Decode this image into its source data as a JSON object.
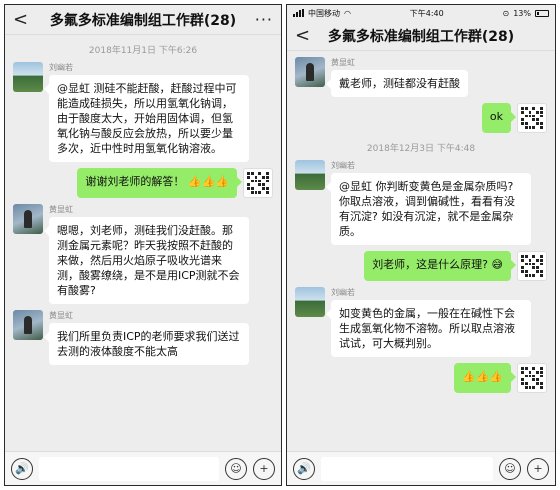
{
  "left": {
    "nav": {
      "back": "<",
      "title": "多氟多标准编制组工作群(28)",
      "more": "···"
    },
    "timestamp": "2018年11月1日 下午6:26",
    "messages": [
      {
        "dir": "in",
        "sender": "刘幽若",
        "text": "@显虹 测硅不能赶酸，赶酸过程中可能造成硅损失，所以用氢氧化钠调，由于酸度太大，开始用固体调，但氢氧化钠与酸反应会放热，所以要少量多次，近中性时用氢氧化钠溶液。"
      },
      {
        "dir": "out",
        "text": "谢谢刘老师的解答！",
        "emoji": "👍👍👍"
      },
      {
        "dir": "in",
        "sender": "黄显虹",
        "text": "嗯嗯，刘老师，测硅我们没赶酸。那测金属元素呢？昨天我按照不赶酸的来做，然后用火焰原子吸收光谱来测，酸雾缭绕，是不是用ICP测就不会有酸雾?"
      },
      {
        "dir": "in",
        "sender": "黄显虹",
        "text": "我们所里负责ICP的老师要求我们送过去测的液体酸度不能太高"
      }
    ]
  },
  "right": {
    "status": {
      "carrier": "中国移动",
      "time": "下午4:40",
      "battery": "13%"
    },
    "nav": {
      "back": "<",
      "title": "多氟多标准编制组工作群(28)"
    },
    "messages_top": [
      {
        "dir": "in",
        "sender": "黄显虹",
        "text": "戴老师，测硅都没有赶酸"
      },
      {
        "dir": "out",
        "text": "ok"
      }
    ],
    "timestamp": "2018年12月3日 下午4:48",
    "messages_bottom": [
      {
        "dir": "in",
        "sender": "刘幽若",
        "text": "@显虹 你判断变黄色是金属杂质吗? 你取点溶液，调到偏碱性，看看有没有沉淀? 如没有沉淀，就不是金属杂质。"
      },
      {
        "dir": "out",
        "text": "刘老师，这是什么原理?",
        "emoji": "😅"
      },
      {
        "dir": "in",
        "sender": "刘幽若",
        "text": "如变黄色的金属，一般在在碱性下会生成氢氧化物不溶物。所以取点溶液试试，可大概判别。"
      },
      {
        "dir": "out",
        "text": "",
        "emoji": "👍👍👍"
      }
    ]
  },
  "inputbar": {
    "voice_icon": "🔊",
    "emoji_icon": "☺",
    "plus_icon": "+"
  },
  "colors": {
    "bubble_out": "#95ec69",
    "bubble_in": "#ffffff",
    "chat_bg": "#ededed"
  }
}
